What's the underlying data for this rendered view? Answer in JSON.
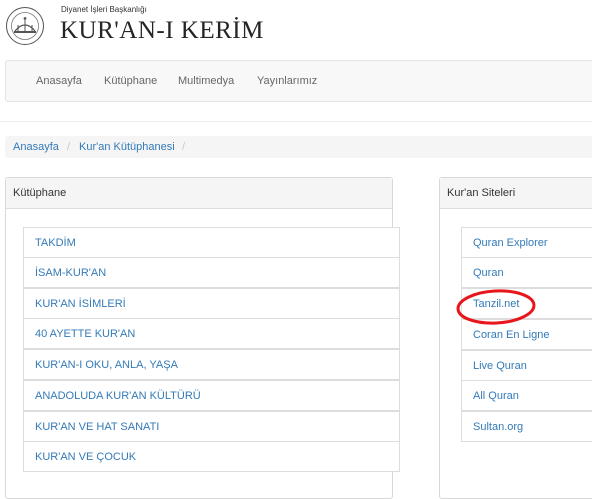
{
  "header": {
    "org_name": "Diyanet İşleri Başkanlığı",
    "site_title": "KUR'AN-I KERİM"
  },
  "nav": {
    "items": [
      "Anasayfa",
      "Kütüphane",
      "Multimedya",
      "Yayınlarımız"
    ]
  },
  "breadcrumb": {
    "items": [
      "Anasayfa",
      "Kur'an Kütüphanesi"
    ],
    "separator": "/"
  },
  "library_panel": {
    "title": "Kütüphane",
    "items": [
      "TAKDİM",
      "İSAM-KUR'AN",
      "KUR'AN İSİMLERİ",
      "40 AYETTE KUR'AN",
      "KUR'AN-I OKU, ANLA, YAŞA",
      "ANADOLUDA KUR'AN KÜLTÜRÜ",
      "KUR'AN VE HAT SANATI",
      "KUR'AN VE ÇOCUK"
    ]
  },
  "sites_panel": {
    "title": "Kur'an Siteleri",
    "items": [
      "Quran Explorer",
      "Quran",
      "Tanzil.net",
      "Coran En Ligne",
      "Live Quran",
      "All Quran",
      "Sultan.org"
    ],
    "highlighted_item": "Tanzil.net"
  },
  "colors": {
    "link": "#337ab7",
    "highlight_ring": "#e8151b",
    "panel_heading_bg": "#f5f5f5"
  }
}
